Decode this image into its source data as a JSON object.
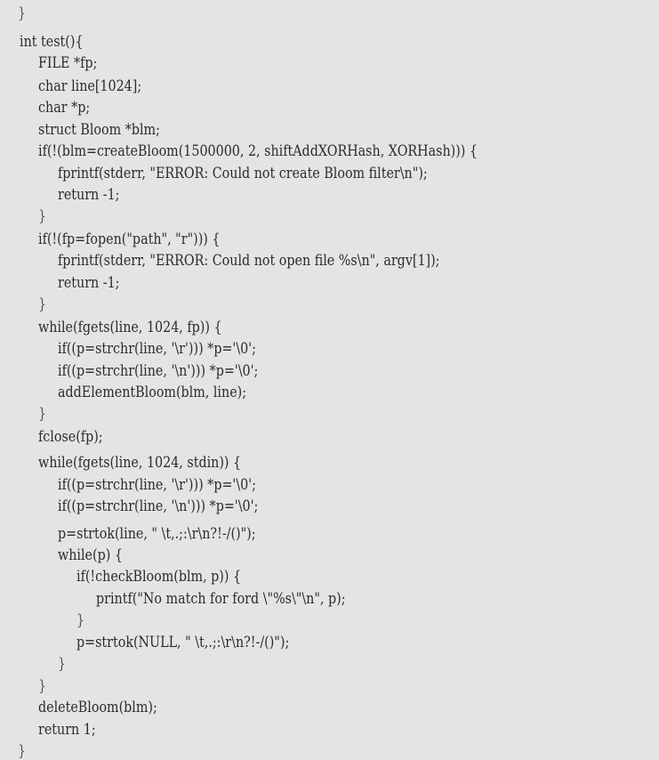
{
  "code": {
    "lines": [
      "}",
      "int test(){",
      "FILE *fp;",
      "char line[1024];",
      "char *p;",
      "struct Bloom *blm;",
      "if(!(blm=createBloom(1500000, 2, shiftAddXORHash, XORHash))) {",
      "fprintf(stderr, \"ERROR: Could not create Bloom filter\\n\");",
      "return -1;",
      "}",
      "if(!(fp=fopen(\"path\", \"r\"))) {",
      "fprintf(stderr, \"ERROR: Could not open file %s\\n\", argv[1]);",
      "return -1;",
      "}",
      "while(fgets(line, 1024, fp)) {",
      "if((p=strchr(line, '\\r'))) *p='\\0';",
      "if((p=strchr(line, '\\n'))) *p='\\0';",
      "addElementBloom(blm, line);",
      "}",
      "fclose(fp);",
      "while(fgets(line, 1024, stdin)) {",
      "if((p=strchr(line, '\\r'))) *p='\\0';",
      "if((p=strchr(line, '\\n'))) *p='\\0';",
      "p=strtok(line, \" \\t,.;:\\r\\n?!-/()\");",
      "while(p) {",
      "if(!checkBloom(blm, p)) {",
      "printf(\"No match for ford \\\"%s\\\"\\n\", p);",
      "}",
      "p=strtok(NULL, \" \\t,.;:\\r\\n?!-/()\");",
      "}",
      "}",
      "deleteBloom(blm);",
      "return 1;",
      "}"
    ]
  }
}
